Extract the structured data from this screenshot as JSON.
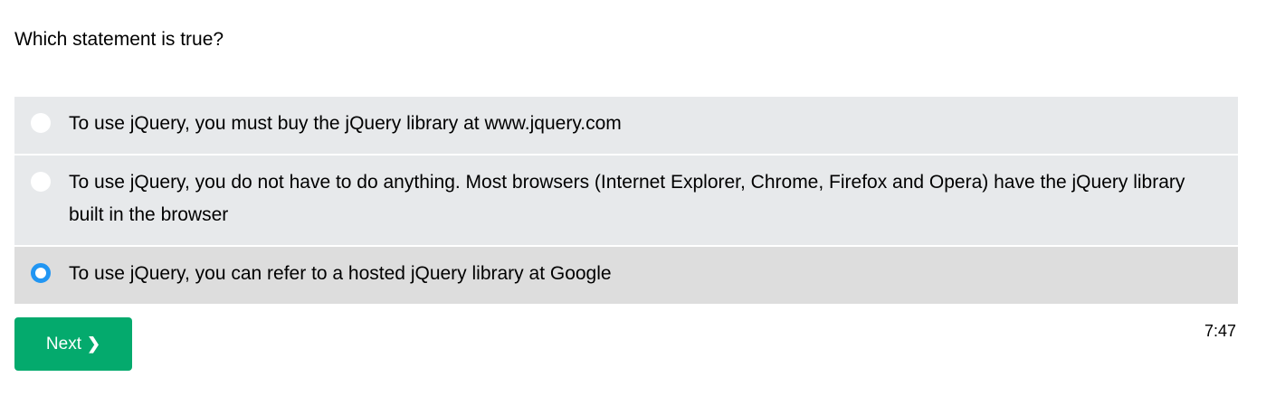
{
  "question": {
    "text": "Which statement is true?"
  },
  "options": [
    {
      "label": "To use jQuery, you must buy the jQuery library at www.jquery.com",
      "selected": false
    },
    {
      "label": "To use jQuery, you do not have to do anything. Most browsers (Internet Explorer, Chrome, Firefox and Opera) have the jQuery library built in the browser",
      "selected": false
    },
    {
      "label": "To use jQuery, you can refer to a hosted jQuery library at Google",
      "selected": true
    }
  ],
  "next_button": {
    "label": "Next",
    "icon": "chevron-right-icon"
  },
  "timer": {
    "text": "7:47"
  },
  "colors": {
    "option_bg": "#e7e9eb",
    "option_selected_bg": "#dddddd",
    "radio_accent": "#2196f3",
    "button_green": "#04aa6d"
  }
}
